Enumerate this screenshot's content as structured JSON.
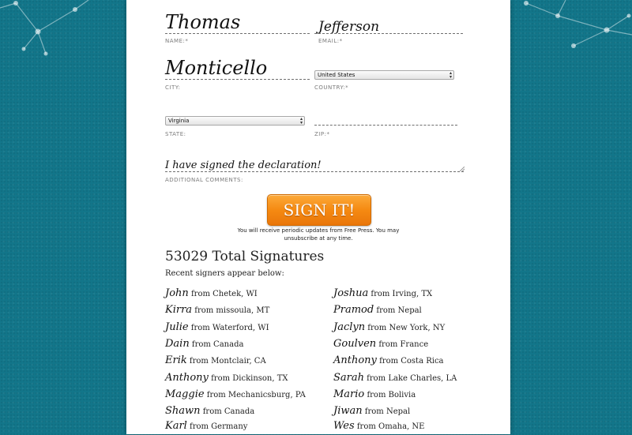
{
  "form": {
    "first_name": "Thomas",
    "last_name": "Jefferson",
    "name_label": "NAME:*",
    "email_label": "EMAIL:*",
    "city": "Monticello",
    "city_label": "CITY:",
    "country": "United States",
    "country_label": "COUNTRY:*",
    "state": "Virginia",
    "state_label": "STATE:",
    "zip": "",
    "zip_label": "ZIP:*",
    "comments": "I have signed the declaration!",
    "comments_label": "ADDITIONAL COMMENTS:"
  },
  "sign_button": "SIGN IT!",
  "disclaimer": "You will receive periodic updates from Free Press. You may unsubscribe at any time.",
  "total_signatures": "53029 Total Signatures",
  "recent_label": "Recent signers appear below:",
  "signers_left": [
    {
      "name": "John",
      "from": " from Chetek, WI"
    },
    {
      "name": "Kirra",
      "from": " from missoula, MT"
    },
    {
      "name": "Julie",
      "from": " from Waterford, WI"
    },
    {
      "name": "Dain",
      "from": " from Canada"
    },
    {
      "name": "Erik",
      "from": " from Montclair, CA"
    },
    {
      "name": "Anthony",
      "from": " from Dickinson, TX"
    },
    {
      "name": "Maggie",
      "from": " from Mechanicsburg, PA"
    },
    {
      "name": "Shawn",
      "from": " from Canada"
    },
    {
      "name": "Karl",
      "from": " from Germany"
    }
  ],
  "signers_right": [
    {
      "name": "Joshua",
      "from": " from Irving, TX"
    },
    {
      "name": "Pramod",
      "from": " from Nepal"
    },
    {
      "name": "Jaclyn",
      "from": " from New York, NY"
    },
    {
      "name": "Goulven",
      "from": " from France"
    },
    {
      "name": "Anthony",
      "from": " from Costa Rica"
    },
    {
      "name": "Sarah",
      "from": " from Lake Charles, LA"
    },
    {
      "name": "Mario",
      "from": " from Bolivia"
    },
    {
      "name": "Jiwan",
      "from": " from Nepal"
    },
    {
      "name": "Wes",
      "from": " from Omaha, NE"
    }
  ],
  "colors": {
    "background": "#12768a",
    "button": "#f58a12",
    "panel": "#ffffff"
  }
}
